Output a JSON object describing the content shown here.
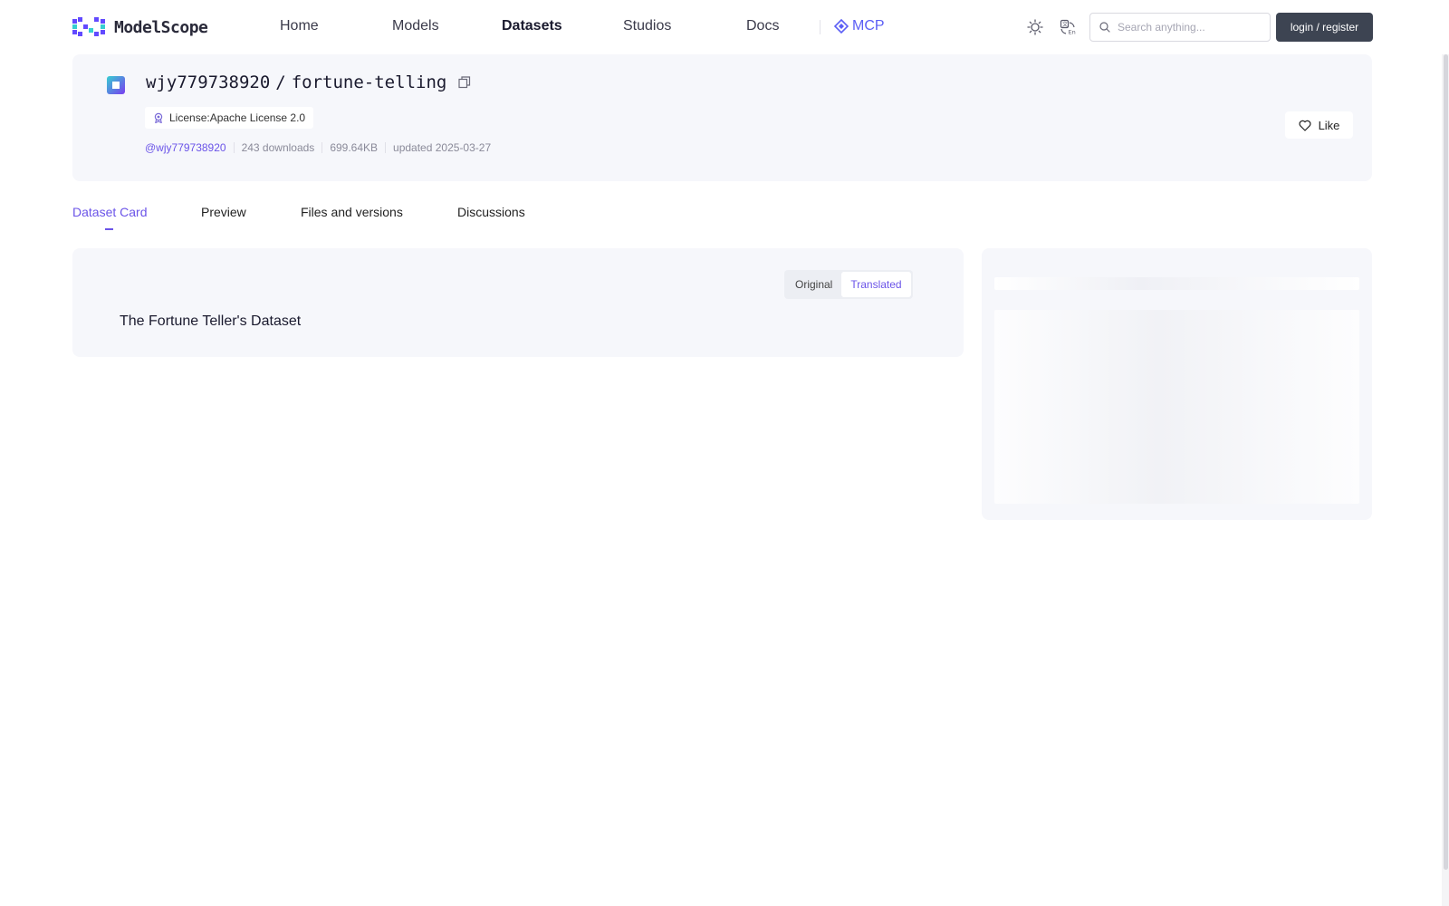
{
  "brand": {
    "name": "ModelScope",
    "accent": "#6b54e8",
    "mcp_color": "#5b5ef5"
  },
  "nav": {
    "items": [
      {
        "label": "Home",
        "active": false
      },
      {
        "label": "Models",
        "active": false
      },
      {
        "label": "Datasets",
        "active": true
      },
      {
        "label": "Studios",
        "active": false
      },
      {
        "label": "Docs",
        "active": false
      }
    ],
    "mcp_label": "MCP",
    "theme_icon": "sun-icon",
    "language_icon": "language-switch-icon",
    "search_placeholder": "Search anything...",
    "login_label": "login / register"
  },
  "dataset": {
    "owner": "wjy779738920",
    "separator": "/",
    "name": "fortune-telling",
    "license": "License:Apache License 2.0",
    "user_handle": "@wjy779738920",
    "downloads": "243 downloads",
    "size": "699.64KB",
    "updated": "updated 2025-03-27",
    "like_label": "Like"
  },
  "tabs": [
    {
      "label": "Dataset Card",
      "active": true
    },
    {
      "label": "Preview",
      "active": false
    },
    {
      "label": "Files and versions",
      "active": false
    },
    {
      "label": "Discussions",
      "active": false
    }
  ],
  "card": {
    "toggle": {
      "original": "Original",
      "translated": "Translated",
      "selected": "Translated"
    },
    "title": "The Fortune Teller's Dataset"
  }
}
